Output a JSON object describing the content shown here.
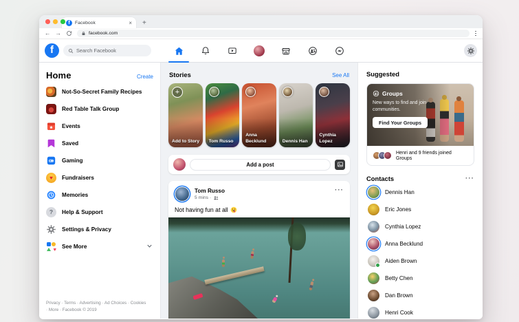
{
  "browser": {
    "tab_title": "Facebook",
    "close_glyph": "×",
    "new_tab_glyph": "+",
    "back_glyph": "←",
    "forward_glyph": "→",
    "url": "facebook.com"
  },
  "header": {
    "search_placeholder": "Search Facebook",
    "nav_icons": [
      "home-icon",
      "notifications-icon",
      "watch-icon",
      "profile-avatar",
      "marketplace-icon",
      "groups-icon",
      "messenger-icon"
    ],
    "active_nav": "home-icon"
  },
  "sidebar": {
    "title": "Home",
    "create_label": "Create",
    "items": [
      {
        "label": "Not-So-Secret Family Recipes",
        "icon": "group-photo-icon"
      },
      {
        "label": "Red Table Talk Group",
        "icon": "group-photo-icon"
      },
      {
        "label": "Events",
        "icon": "events-icon"
      },
      {
        "label": "Saved",
        "icon": "saved-bookmark-icon"
      },
      {
        "label": "Gaming",
        "icon": "gaming-icon"
      },
      {
        "label": "Fundraisers",
        "icon": "fundraisers-heart-icon"
      },
      {
        "label": "Memories",
        "icon": "memories-clock-icon"
      },
      {
        "label": "Help & Support",
        "icon": "help-question-icon"
      },
      {
        "label": "Settings & Privacy",
        "icon": "settings-gear-icon"
      },
      {
        "label": "See More",
        "icon": "see-more-grid-icon"
      }
    ],
    "footer": "Privacy · Terms · Advertising · Ad Choices · Cookies · More · Facebook © 2019"
  },
  "stories": {
    "title": "Stories",
    "see_all_label": "See All",
    "cards": [
      {
        "name": "Add to Story",
        "type": "add-story"
      },
      {
        "name": "Tom Russo",
        "type": "friend-story"
      },
      {
        "name": "Anna Becklund",
        "type": "friend-story"
      },
      {
        "name": "Dennis Han",
        "type": "friend-story"
      },
      {
        "name": "Cynthia Lopez",
        "type": "friend-story"
      }
    ]
  },
  "composer": {
    "placeholder": "Add a post"
  },
  "post": {
    "author": "Tom Russo",
    "meta": "5 mins ·",
    "audience_icon": "friends-icon",
    "text": "Not having fun at all",
    "emoji": "😛"
  },
  "suggested": {
    "title": "Suggested",
    "group_card": {
      "title": "Groups",
      "description": "New ways to find and join communities.",
      "button_label": "Find Your Groups",
      "joined_text": "Henri and 9 friends joined Groups"
    }
  },
  "contacts": {
    "title": "Contacts",
    "people": [
      {
        "name": "Dennis Han",
        "has_story": true
      },
      {
        "name": "Eric Jones"
      },
      {
        "name": "Cynthia Lopez"
      },
      {
        "name": "Anna Becklund",
        "has_story": true
      },
      {
        "name": "Aiden Brown",
        "online": true
      },
      {
        "name": "Betty Chen"
      },
      {
        "name": "Dan Brown"
      },
      {
        "name": "Henri Cook"
      }
    ]
  },
  "ui": {
    "ellipsis": "···",
    "colors": {
      "brand_blue": "#1877f2",
      "feed_bg": "#f0f2f5",
      "online_green": "#31a24c"
    }
  }
}
